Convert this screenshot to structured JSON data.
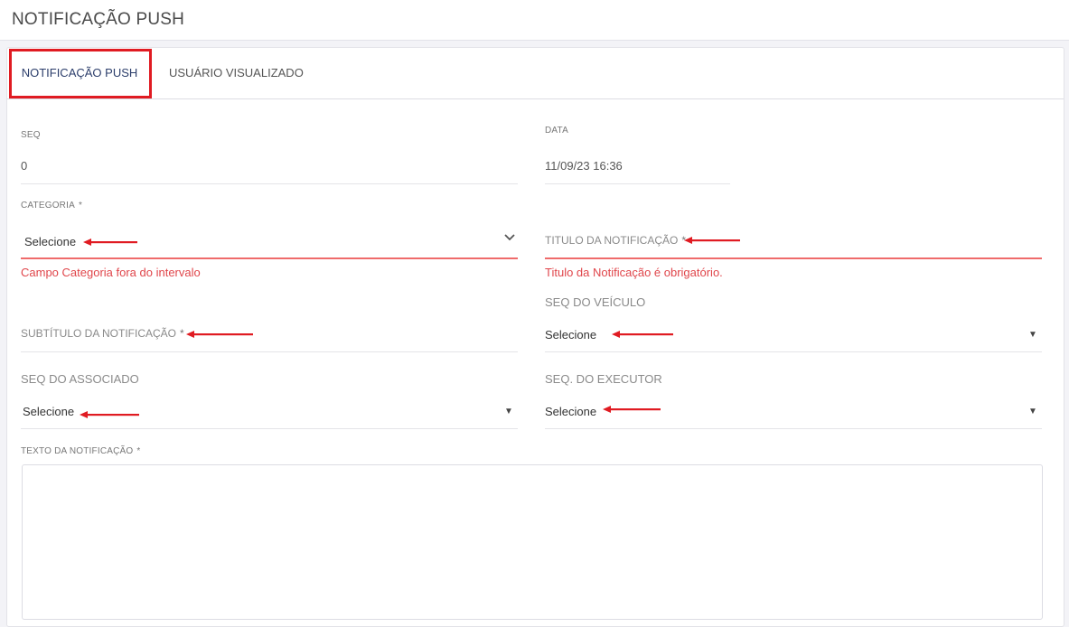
{
  "page": {
    "title": "NOTIFICAÇÃO PUSH"
  },
  "tabs": [
    {
      "label": "NOTIFICAÇÃO PUSH",
      "active": true
    },
    {
      "label": "USUÁRIO VISUALIZADO",
      "active": false
    }
  ],
  "form": {
    "seq": {
      "label": "SEQ",
      "value": "0"
    },
    "data": {
      "label": "DATA",
      "value": "11/09/23 16:36"
    },
    "categoria": {
      "label": "CATEGORIA",
      "required": "*",
      "value": "Selecione",
      "error": "Campo Categoria fora do intervalo"
    },
    "titulo": {
      "label": "TITULO DA NOTIFICAÇÃO",
      "required": "*",
      "error": "Titulo da Notificação é obrigatório."
    },
    "subtitulo": {
      "label": "SUBTÍTULO DA NOTIFICAÇÃO",
      "required": "*"
    },
    "seq_veiculo": {
      "label": "SEQ DO VEÍCULO",
      "value": "Selecione"
    },
    "seq_associado": {
      "label": "SEQ DO ASSOCIADO",
      "value": "Selecione"
    },
    "seq_executor": {
      "label": "SEQ. DO EXECUTOR",
      "value": "Selecione"
    },
    "texto": {
      "label": "TEXTO DA NOTIFICAÇÃO",
      "required": "*",
      "value": ""
    }
  },
  "icons": {
    "dropdown_caret": "▼",
    "annotation_arrow": "red-arrow-left"
  },
  "colors": {
    "error": "#e0464b",
    "highlight": "#e01b22",
    "active_tab_text": "#2c3e6b"
  }
}
